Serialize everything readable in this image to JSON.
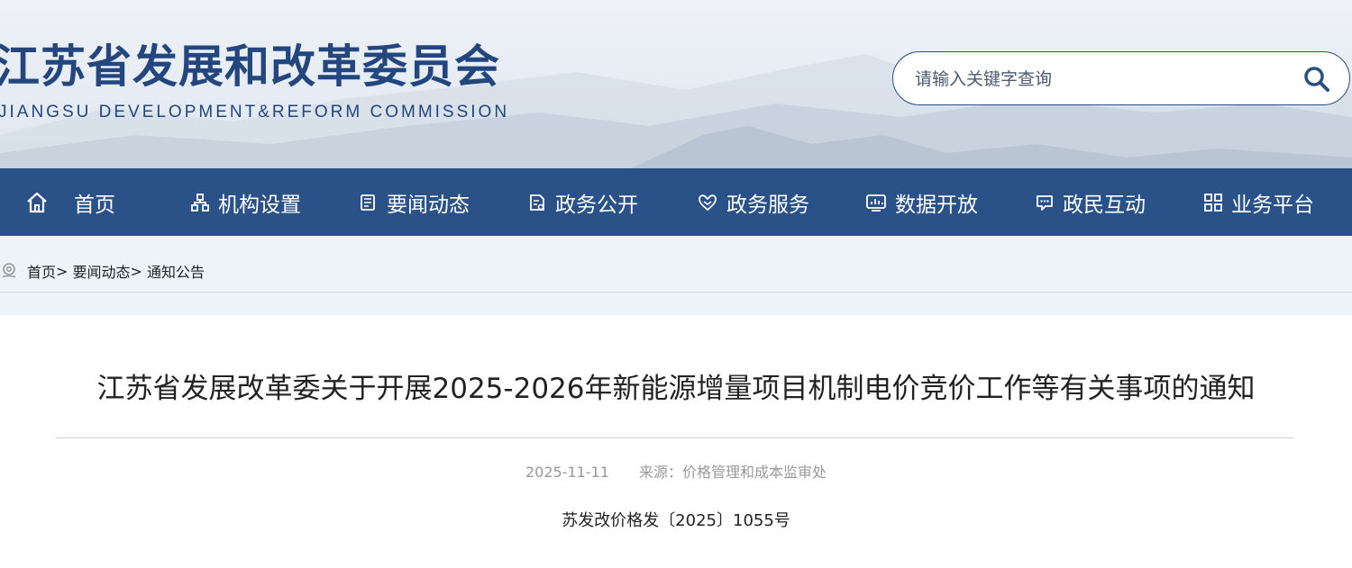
{
  "header": {
    "title": "江苏省发展和改革委员会",
    "subtitle": "JIANGSU DEVELOPMENT&REFORM COMMISSION",
    "search_placeholder": "请输入关键字查询",
    "search_icon": "search-icon"
  },
  "nav": {
    "items": [
      {
        "label": "首页",
        "icon": "home-icon"
      },
      {
        "label": "机构设置",
        "icon": "org-chart-icon"
      },
      {
        "label": "要闻动态",
        "icon": "news-icon"
      },
      {
        "label": "政务公开",
        "icon": "document-icon"
      },
      {
        "label": "政务服务",
        "icon": "service-icon"
      },
      {
        "label": "数据开放",
        "icon": "data-icon"
      },
      {
        "label": "政民互动",
        "icon": "chat-icon"
      },
      {
        "label": "业务平台",
        "icon": "grid-icon"
      }
    ]
  },
  "breadcrumb": {
    "icon": "location-icon",
    "items": [
      "首页",
      "要闻动态",
      "通知公告"
    ],
    "separator": ">"
  },
  "article": {
    "title": "江苏省发展改革委关于开展2025-2026年新能源增量项目机制电价竞价工作等有关事项的通知",
    "date": "2025-11-11",
    "source": "来源：价格管理和成本监审处",
    "doc_number": "苏发改价格发〔2025〕1055号"
  },
  "colors": {
    "brand_blue": "#2b5189",
    "title_blue": "#23467f"
  }
}
